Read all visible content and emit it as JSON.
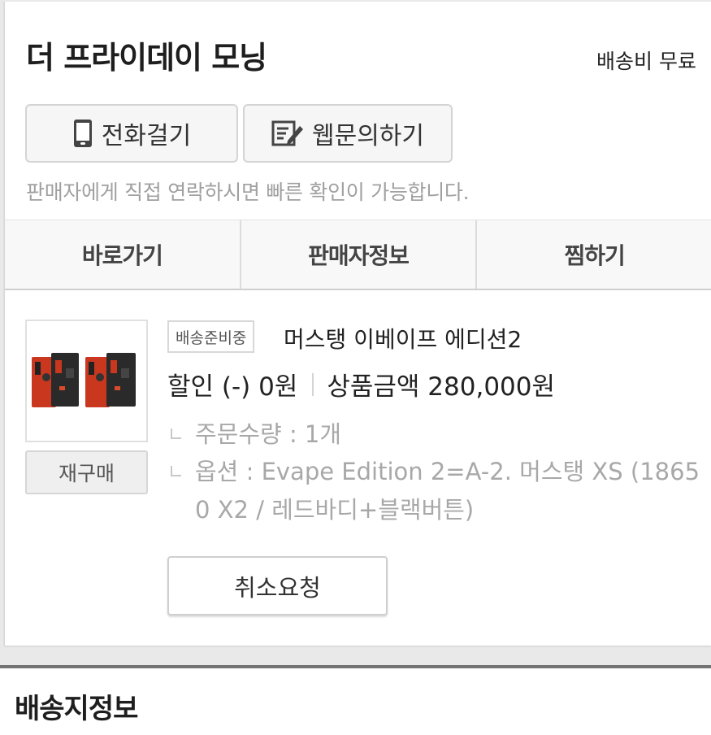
{
  "seller": {
    "name": "더 프라이데이 모닝",
    "shipping_fee": "배송비 무료"
  },
  "contact": {
    "call_label": "전화걸기",
    "call_icon": "phone-icon",
    "web_label": "웹문의하기",
    "web_icon": "write-icon",
    "note": "판매자에게 직접 연락하시면 빠른 확인이 가능합니다."
  },
  "tabs": [
    {
      "label": "바로가기"
    },
    {
      "label": "판매자정보"
    },
    {
      "label": "찜하기"
    }
  ],
  "order": {
    "status_badge": "배송준비중",
    "product_name": "머스탱 이베이프 에디션2",
    "discount": "할인 (-) 0원",
    "product_price": "상품금액 280,000원",
    "quantity": "주문수량 : 1개",
    "option_line1": "옵션 : Evape Edition 2=A-2. 머스탱 XS (1865",
    "option_line2": "0 X2 / 레드바디+블랙버튼)",
    "reorder_label": "재구매",
    "cancel_label": "취소요청"
  },
  "shipping_section": {
    "title": "배송지정보"
  }
}
